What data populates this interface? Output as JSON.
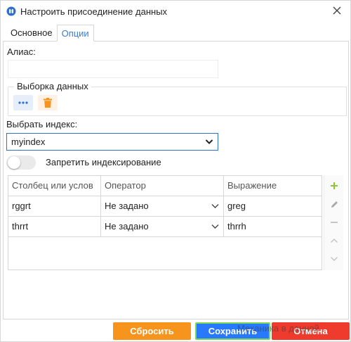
{
  "window": {
    "title": "Настроить присоединение данных"
  },
  "tabs": [
    {
      "label": "Основное",
      "active": false
    },
    {
      "label": "Опции",
      "active": true
    }
  ],
  "alias": {
    "label": "Алиас:",
    "value": ""
  },
  "data_selection": {
    "legend": "Выборка данных"
  },
  "index": {
    "label": "Выбрать индекс:",
    "value": "myindex"
  },
  "toggle": {
    "label": "Запретить индексирование",
    "on": false
  },
  "grid": {
    "headers": [
      "Столбец или услов",
      "Оператор",
      "Выражение"
    ],
    "rows": [
      {
        "column": "rggrt",
        "operator": "Не задано",
        "expression": "greg"
      },
      {
        "column": "thrrt",
        "operator": "Не задано",
        "expression": "thrrh"
      }
    ]
  },
  "buttons": {
    "reset": "Сбросить",
    "save": "Сохранить",
    "cancel": "Отмена"
  },
  "watermark": "Механика в данной",
  "colors": {
    "accent": "#2979ff",
    "reset": "#f7941d",
    "cancel": "#ef3b2d",
    "add_icon": "#8cc63f",
    "delete_icon": "#f7941d"
  }
}
